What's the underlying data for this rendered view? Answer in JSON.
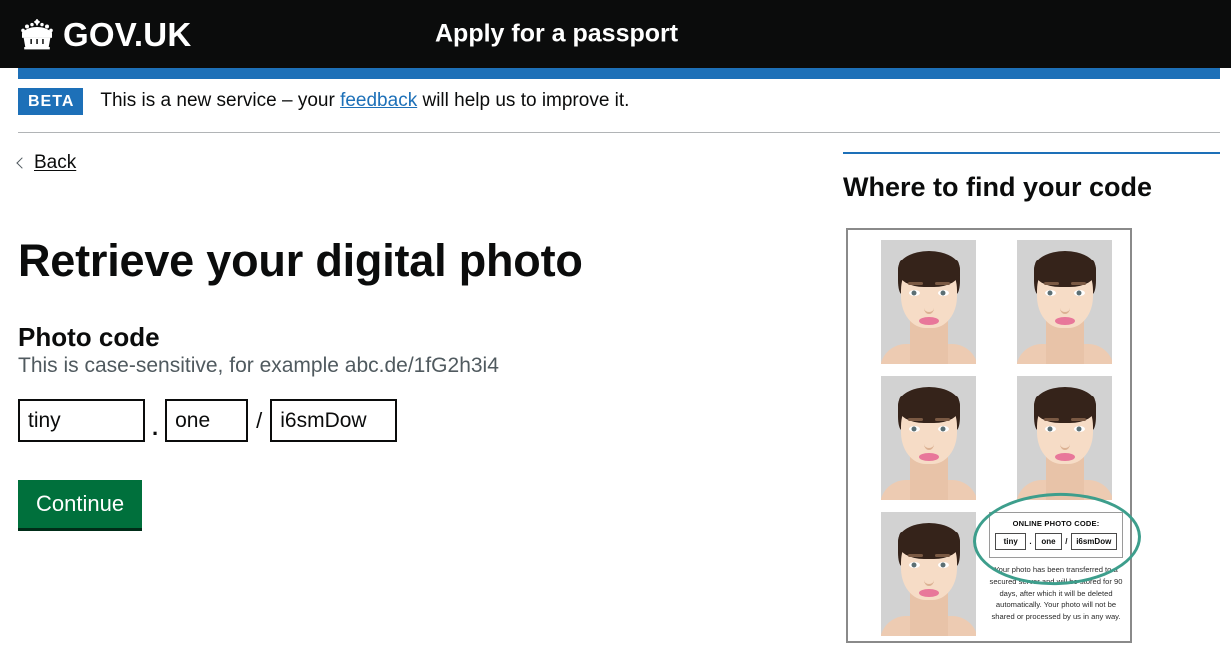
{
  "header": {
    "logo_icon": "crown-icon",
    "wordmark": "GOV.UK",
    "service_name": "Apply for a passport"
  },
  "phase_banner": {
    "tag": "BETA",
    "text_before": "This is a new service – your ",
    "link": "feedback",
    "text_after": " will help us to improve it."
  },
  "back_link": {
    "label": "Back",
    "icon": "chevron-left-icon"
  },
  "main": {
    "heading": "Retrieve your digital photo",
    "field_label": "Photo code",
    "field_hint": "This is case-sensitive, for example abc.de/1fG2h3i4",
    "inputs": [
      {
        "name": "photo-code-part-1",
        "value": "tiny",
        "placeholder": ""
      },
      {
        "name": "photo-code-part-2",
        "value": "one",
        "placeholder": ""
      },
      {
        "name": "photo-code-part-3",
        "value": "i6smDow",
        "placeholder": ""
      }
    ],
    "separator_dot": ".",
    "separator_slash": "/",
    "continue_label": "Continue"
  },
  "sidebar": {
    "heading": "Where to find your code",
    "photo_sheet": {
      "code_box_title": "ONLINE PHOTO CODE:",
      "code_parts": [
        "tiny",
        "one",
        "i6smDow"
      ],
      "separator_dot": ".",
      "separator_slash": "/",
      "note": "Your photo has been transferred to a secured server and will be stored for 90 days, after which it will be deleted automatically. Your photo will not be shared or processed by us in any way.",
      "photo_count": 5
    }
  },
  "colors": {
    "header_background": "#0b0c0c",
    "brand_blue": "#1d70b8",
    "button_green": "#00703c",
    "button_green_shadow": "#002d18",
    "highlight_teal": "#3d9e8c",
    "hint_grey": "#505a5f",
    "border_grey": "#b1b4b6"
  }
}
